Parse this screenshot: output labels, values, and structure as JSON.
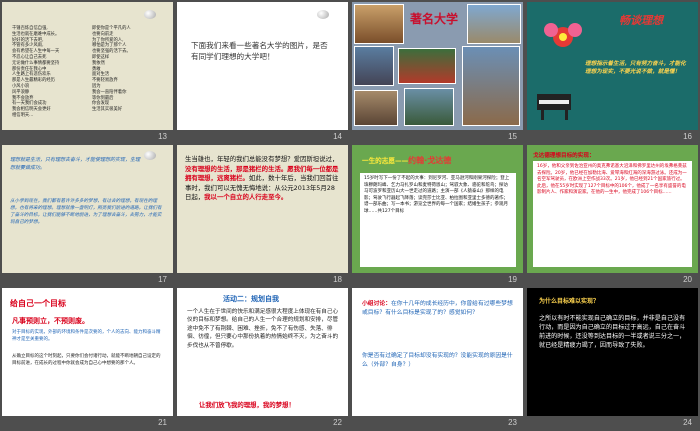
{
  "slides": [
    {
      "number": "13",
      "left_lines": [
        "千锤百炼自信自强,",
        "生活也就在磨难中成长。",
        "好好的活下去吧,",
        "不管有多少风雨,",
        "会有希望在人生中每一天",
        "不忍心让自己去死",
        "无论做什么事情都要坚持",
        "那份责任在我心中",
        "人生路上有悲伤欢乐",
        "那是人生最精彩的经历",
        "小风小浪",
        "风平浪静",
        "我不会放弃",
        "有一天我们会成功",
        "我会相信明天会更好",
        "相信明天..."
      ],
      "right_lines": [
        "即使你是个平凡的人",
        "也要向前走",
        "为了你所爱的人,",
        "哪怕是为了那个人",
        "也要坚强的活下去。",
        "即使这样",
        "我依然",
        "勇敢",
        "面对生活",
        "不要轻易放弃",
        "因为",
        "我会一直陪伴着你",
        "等你到最后",
        "你会发现",
        "生活其实很美好"
      ]
    },
    {
      "number": "14",
      "text": "下面我们来看一些著名大学的图片，是否有同学们理想的大学吧！"
    },
    {
      "number": "15",
      "title": "著名大学"
    },
    {
      "number": "16",
      "title": "畅谈理想",
      "body": "理想指示着生活，只有努力奋斗，才能化理想为现实，不要光说不做，就是懂！"
    },
    {
      "number": "17",
      "top": "理想就是生活，只有理想去奋斗，才能使理想的实现，生理想就要做成功。",
      "bottom": "从小学到现在，我们都有着许许多多的梦想，有过去的理想，有现在的理想，也有将来的理想。理想就像一盏明灯，照亮我们前进的道路，让我们有了奋斗的目标，让我们能够不断地前进，为了理想去奋斗，去努力，才能实现自己的梦想。"
    },
    {
      "number": "18",
      "body_a": "生当雄也，年轻的我们总能没有梦想？爱因斯坦说过，",
      "body_red": "没有理想的生活，那是猪栏的生活。愿我们每一位都是拥有理想，远离猪栏。",
      "body_b": "如此，数十年后，当我们回首往事时，我们可以无愧无悔地说：从公元2013年5月28日起，",
      "body_red2": "我以一个自立的人行走至今。"
    },
    {
      "number": "19",
      "heading_prefix": "一生的志愿",
      "heading_name": "约翰·戈达德",
      "body": "15岁时写下一份了不起的大事：到尼罗河、亚马逊河和刚果河探险；登上珠穆朗玛峰、乞力马扎罗山和麦特荷恩山；驾驭大象、骆驼和鸵鸟；探访马可波罗和亚历山大一世走过的道路；主演一部《人猿泰山》那样的电影；驾驶飞行器起飞降落；读完莎士比亚、柏拉图和亚里士多德的著作；谱一部乐曲；写一本书；游览全世界的每一个国家；结婚生孩子；参观月球……共127个目标"
    },
    {
      "number": "20",
      "heading": "戈达德理想目标的实现：",
      "body": "16岁，他和父亲到佐治亚州的奥克弗诺基大沼泽和佛罗里达州的埃弗格莱兹去探险。20岁，他已经在加勒比海、爱琴海和红海的深海游过泳。还成为一名空军驾驶员，在欧洲上空作战33次。21岁，他已经到21个国家旅行过。此后，他在55岁时实现了127个目标中的106个，他成了一名享有盛誉的电影制片人、作家和演说家。在他的一生中，他完成了106个目标……"
    },
    {
      "number": "21",
      "heading": "给自己一个目标",
      "red_line": "凡事预则立，不预则废。",
      "blue_text": "对于目标的实现，外部的环境和条件是次要的，个人的志向、能力和奋斗精神才是至关重要的。",
      "black_text": "从确立目标的这个时刻起，只要你们会付诸行动，就能不断地朝自己设定的目标前进，在成长的过程中你就会成为自己心中想要的那个人。"
    },
    {
      "number": "22",
      "heading": "活动二：规划自我",
      "body": "一个人生在于世间的快乐和满足感很大程度上体现在有自己心仪的目标和梦想。给自己的人生一个合理的规划和安排，尽管途中免不了有荆棘、困难、挫折，免不了有伤感、失落、徘徊、彷徨，但只要心中那份执着的热情始终不灭，为之奋斗的步伐也从不曾停歇。",
      "footer": "让我们放飞我的理想，我的梦想！"
    },
    {
      "number": "23",
      "line1_label": "小组讨论：",
      "line1": "在你十几年的成长经历中，你曾给有过哪些梦想或目标？有什么目标是实现了的？感觉如何？",
      "line2": "你是否有过确定了目标却没有实现的？没能实现的原因是什么（外部？自身？）"
    },
    {
      "number": "24",
      "heading": "为什么目标难以实现？",
      "body": "之所以有时不能实现自己确立的目标，并非是自己没有行动，而是因为自己确立的目标过于高远，自己在奋斗前进的时候，还没等到达目标的一半或者说三分之一，就已经是精疲力竭了，因而导致了失败。"
    }
  ],
  "colors": {
    "page_bg": "#4e4e4e",
    "beige": "#e7e4cf",
    "teal": "#1b6c6a",
    "green": "#6aa84f",
    "red": "#d9001b"
  }
}
